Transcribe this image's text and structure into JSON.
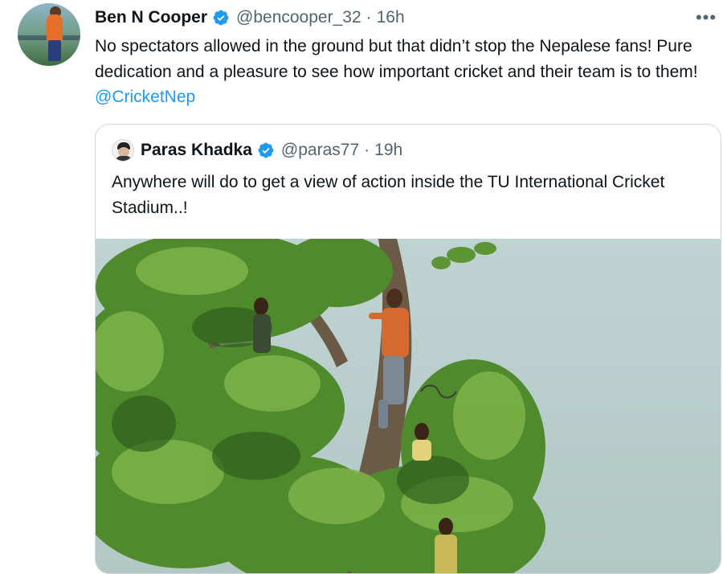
{
  "tweet": {
    "author_name": "Ben N Cooper",
    "author_handle": "@bencooper_32",
    "separator": "·",
    "time": "16h",
    "more_label": "•••",
    "text_before_mention": "No spectators allowed in the ground but that didn’t stop the Nepalese fans! Pure dedication and a pleasure to see how important cricket and their team is to them! ",
    "mention": "@CricketNep",
    "verified": true
  },
  "quoted_tweet": {
    "author_name": "Paras Khadka",
    "author_handle": "@paras77",
    "separator": "·",
    "time": "19h",
    "text": "Anywhere will do to get a view of action inside the TU International Cricket Stadium..!",
    "verified": true
  },
  "icons": {
    "verified": "verified-badge-icon",
    "more": "more-options-icon"
  },
  "colors": {
    "text": "#0f1419",
    "secondary": "#536471",
    "link": "#1d9bf0",
    "border": "#cfd9de"
  }
}
